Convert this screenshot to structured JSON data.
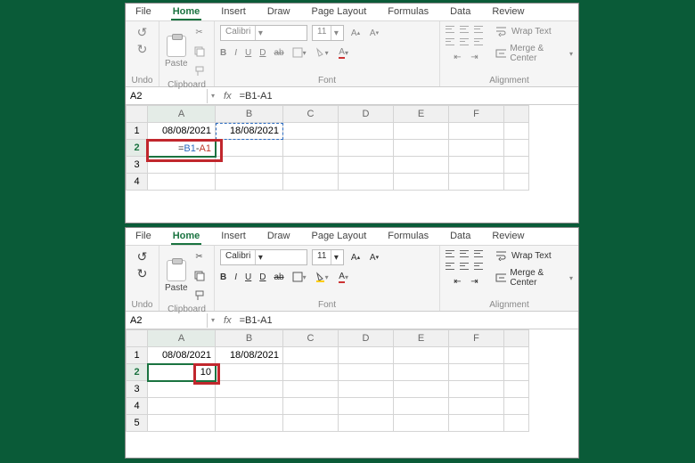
{
  "app": "Microsoft Excel",
  "tabs": [
    "File",
    "Home",
    "Insert",
    "Draw",
    "Page Layout",
    "Formulas",
    "Data",
    "Review"
  ],
  "tabs_active": "Home",
  "ribbon": {
    "undo_label": "Undo",
    "clipboard_label": "Clipboard",
    "paste_label": "Paste",
    "font_label": "Font",
    "font_name": "Calibri",
    "font_size": "11",
    "bold": "B",
    "italic": "I",
    "underline": "U",
    "double_underline": "D",
    "alignment_label": "Alignment",
    "wrap_text": "Wrap Text",
    "merge_center": "Merge & Center"
  },
  "namebox": {
    "cell_ref": "A2",
    "fx": "fx",
    "formula": "=B1-A1"
  },
  "columns": [
    "A",
    "B",
    "C",
    "D",
    "E",
    "F"
  ],
  "panel1": {
    "state": "editing",
    "rows": [
      "1",
      "2",
      "3",
      "4"
    ],
    "A1": "08/08/2021",
    "B1": "18/08/2021",
    "A2_formula_parts": {
      "eq": "=",
      "ref1": "B1",
      "op": "-",
      "ref2": "A1"
    },
    "active_cell": "A2",
    "referenced_cell": "B1"
  },
  "panel2": {
    "state": "result",
    "rows": [
      "1",
      "2",
      "3",
      "4",
      "5"
    ],
    "A1": "08/08/2021",
    "B1": "18/08/2021",
    "A2": "10",
    "active_cell": "A2"
  }
}
